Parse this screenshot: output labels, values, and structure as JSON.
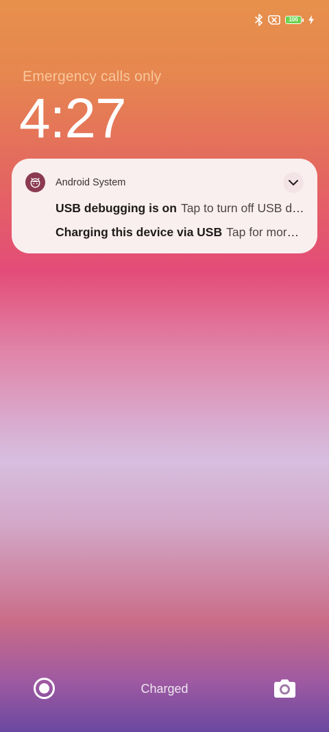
{
  "status_bar": {
    "icons": [
      "bluetooth-icon",
      "no-sim-icon",
      "battery-icon",
      "charging-bolt-icon"
    ],
    "battery_level": "100",
    "battery_fraction": 1.0,
    "battery_color": "#6cd34f"
  },
  "lockscreen": {
    "carrier_text": "Emergency calls only",
    "clock": "4:27"
  },
  "notification": {
    "app_icon": "android-system-icon",
    "app_name": "Android System",
    "expand_icon": "chevron-down-icon",
    "items": [
      {
        "title": "USB debugging is on",
        "text": "Tap to turn off USB debugging"
      },
      {
        "title": "Charging this device via USB",
        "text": "Tap for more options."
      }
    ]
  },
  "bottom_bar": {
    "left_icon": "voice-assist-icon",
    "status_text": "Charged",
    "right_icon": "camera-icon"
  }
}
